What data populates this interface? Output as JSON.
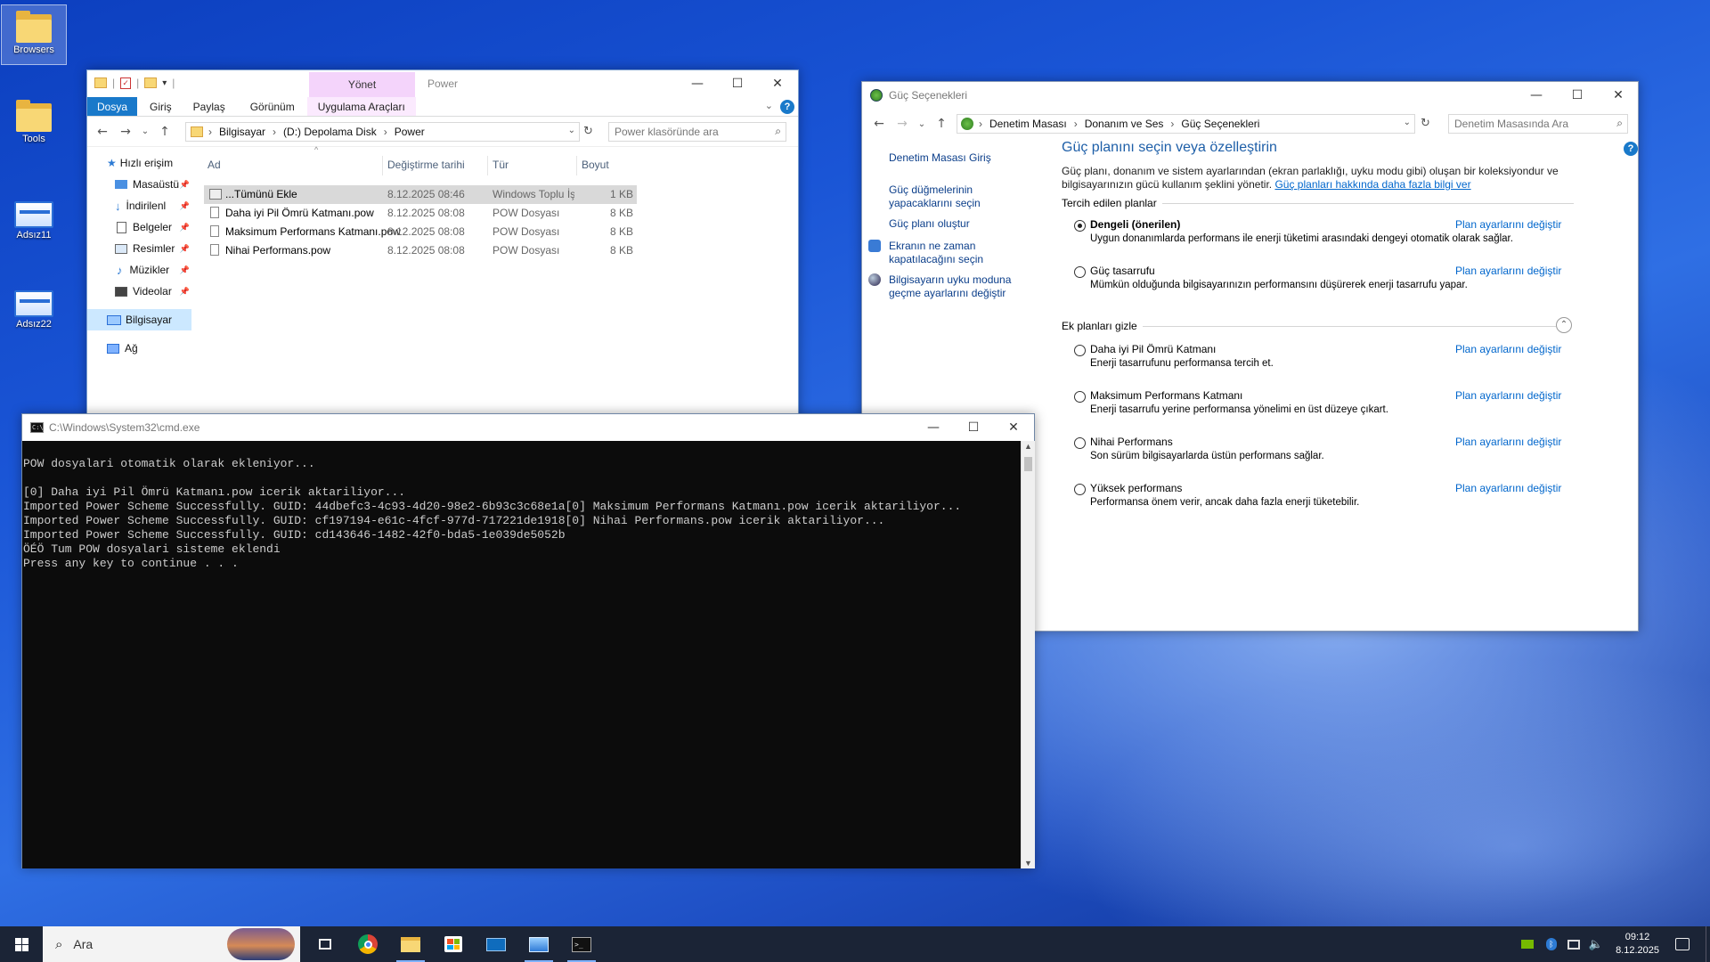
{
  "desktop": {
    "icons": [
      {
        "label": "Browsers"
      },
      {
        "label": "Tools"
      },
      {
        "label": "Adsız11"
      },
      {
        "label": "Adsız22"
      }
    ]
  },
  "explorer": {
    "qat_title": "Power",
    "manage_tab": "Yönet",
    "tabs": [
      "Dosya",
      "Giriş",
      "Paylaş",
      "Görünüm",
      "Uygulama Araçları"
    ],
    "breadcrumb": [
      "Bilgisayar",
      "(D:) Depolama Disk",
      "Power"
    ],
    "search_placeholder": "Power klasöründe ara",
    "sidebar": [
      {
        "label": "Hızlı erişim"
      },
      {
        "label": "Masaüstü"
      },
      {
        "label": "İndirilenl"
      },
      {
        "label": "Belgeler"
      },
      {
        "label": "Resimler"
      },
      {
        "label": "Müzikler"
      },
      {
        "label": "Videolar"
      },
      {
        "label": "Bilgisayar"
      },
      {
        "label": "Ağ"
      }
    ],
    "columns": [
      "Ad",
      "Değiştirme tarihi",
      "Tür",
      "Boyut"
    ],
    "files": [
      {
        "name": "...Tümünü Ekle",
        "date": "8.12.2025 08:46",
        "type": "Windows Toplu İş ...",
        "size": "1 KB"
      },
      {
        "name": "Daha iyi Pil Ömrü Katmanı.pow",
        "date": "8.12.2025 08:08",
        "type": "POW Dosyası",
        "size": "8 KB"
      },
      {
        "name": "Maksimum Performans Katmanı.pow",
        "date": "8.12.2025 08:08",
        "type": "POW Dosyası",
        "size": "8 KB"
      },
      {
        "name": "Nihai Performans.pow",
        "date": "8.12.2025 08:08",
        "type": "POW Dosyası",
        "size": "8 KB"
      }
    ]
  },
  "cmd": {
    "title": "C:\\Windows\\System32\\cmd.exe",
    "lines": [
      "POW dosyalari otomatik olarak ekleniyor...",
      "",
      "[0] Daha iyi Pil Ömrü Katmanı.pow icerik aktariliyor...",
      "Imported Power Scheme Successfully. GUID: 44dbefc3-4c93-4d20-98e2-6b93c3c68e1a[0] Maksimum Performans Katmanı.pow icerik aktariliyor...",
      "Imported Power Scheme Successfully. GUID: cf197194-e61c-4fcf-977d-717221de1918[0] Nihai Performans.pow icerik aktariliyor...",
      "Imported Power Scheme Successfully. GUID: cd143646-1482-42f0-bda5-1e039de5052b",
      "ÖÉÖ Tum POW dosyalari sisteme eklendi",
      "Press any key to continue . . ."
    ]
  },
  "power": {
    "title": "Güç Seçenekleri",
    "breadcrumb": [
      "Denetim Masası",
      "Donanım ve Ses",
      "Güç Seçenekleri"
    ],
    "search_placeholder": "Denetim Masasında Ara",
    "side_links": [
      "Denetim Masası Giriş",
      "Güç düğmelerinin yapacaklarını seçin",
      "Güç planı oluştur",
      "Ekranın ne zaman kapatılacağını seçin",
      "Bilgisayarın uyku moduna geçme ayarlarını değiştir"
    ],
    "heading": "Güç planını seçin veya özelleştirin",
    "description": "Güç planı, donanım ve sistem ayarlarından (ekran parlaklığı, uyku modu gibi) oluşan bir koleksiyondur ve bilgisayarınızın gücü kullanım şeklini yönetir.",
    "description_link": "Güç planları hakkında daha fazla bilgi ver",
    "preferred_label": "Tercih edilen planlar",
    "extra_label": "Ek planları gizle",
    "change_link": "Plan ayarlarını değiştir",
    "preferred_plans": [
      {
        "name": "Dengeli (önerilen)",
        "desc": "Uygun donanımlarda performans ile enerji tüketimi arasındaki dengeyi otomatik olarak sağlar.",
        "selected": true
      },
      {
        "name": "Güç tasarrufu",
        "desc": "Mümkün olduğunda bilgisayarınızın performansını düşürerek enerji tasarrufu yapar.",
        "selected": false
      }
    ],
    "extra_plans": [
      {
        "name": "Daha iyi Pil Ömrü Katmanı",
        "desc": "Enerji tasarrufunu performansa tercih et."
      },
      {
        "name": "Maksimum Performans Katmanı",
        "desc": "Enerji tasarrufu yerine performansa yönelimi en üst düzeye çıkart."
      },
      {
        "name": "Nihai Performans",
        "desc": "Son sürüm bilgisayarlarda üstün performans sağlar."
      },
      {
        "name": "Yüksek performans",
        "desc": "Performansa önem verir, ancak daha fazla enerji tüketebilir."
      }
    ]
  },
  "taskbar": {
    "search_placeholder": "Ara",
    "time": "09:12",
    "date": "8.12.2025"
  }
}
